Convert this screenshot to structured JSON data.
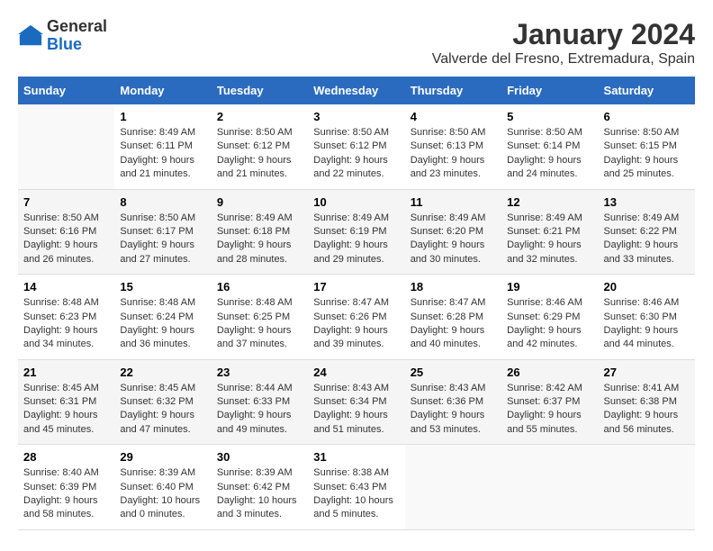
{
  "header": {
    "logo_line1": "General",
    "logo_line2": "Blue",
    "title": "January 2024",
    "subtitle": "Valverde del Fresno, Extremadura, Spain"
  },
  "days_of_week": [
    "Sunday",
    "Monday",
    "Tuesday",
    "Wednesday",
    "Thursday",
    "Friday",
    "Saturday"
  ],
  "weeks": [
    [
      {
        "day": "",
        "info": ""
      },
      {
        "day": "1",
        "info": "Sunrise: 8:49 AM\nSunset: 6:11 PM\nDaylight: 9 hours\nand 21 minutes."
      },
      {
        "day": "2",
        "info": "Sunrise: 8:50 AM\nSunset: 6:12 PM\nDaylight: 9 hours\nand 21 minutes."
      },
      {
        "day": "3",
        "info": "Sunrise: 8:50 AM\nSunset: 6:12 PM\nDaylight: 9 hours\nand 22 minutes."
      },
      {
        "day": "4",
        "info": "Sunrise: 8:50 AM\nSunset: 6:13 PM\nDaylight: 9 hours\nand 23 minutes."
      },
      {
        "day": "5",
        "info": "Sunrise: 8:50 AM\nSunset: 6:14 PM\nDaylight: 9 hours\nand 24 minutes."
      },
      {
        "day": "6",
        "info": "Sunrise: 8:50 AM\nSunset: 6:15 PM\nDaylight: 9 hours\nand 25 minutes."
      }
    ],
    [
      {
        "day": "7",
        "info": "Sunrise: 8:50 AM\nSunset: 6:16 PM\nDaylight: 9 hours\nand 26 minutes."
      },
      {
        "day": "8",
        "info": "Sunrise: 8:50 AM\nSunset: 6:17 PM\nDaylight: 9 hours\nand 27 minutes."
      },
      {
        "day": "9",
        "info": "Sunrise: 8:49 AM\nSunset: 6:18 PM\nDaylight: 9 hours\nand 28 minutes."
      },
      {
        "day": "10",
        "info": "Sunrise: 8:49 AM\nSunset: 6:19 PM\nDaylight: 9 hours\nand 29 minutes."
      },
      {
        "day": "11",
        "info": "Sunrise: 8:49 AM\nSunset: 6:20 PM\nDaylight: 9 hours\nand 30 minutes."
      },
      {
        "day": "12",
        "info": "Sunrise: 8:49 AM\nSunset: 6:21 PM\nDaylight: 9 hours\nand 32 minutes."
      },
      {
        "day": "13",
        "info": "Sunrise: 8:49 AM\nSunset: 6:22 PM\nDaylight: 9 hours\nand 33 minutes."
      }
    ],
    [
      {
        "day": "14",
        "info": "Sunrise: 8:48 AM\nSunset: 6:23 PM\nDaylight: 9 hours\nand 34 minutes."
      },
      {
        "day": "15",
        "info": "Sunrise: 8:48 AM\nSunset: 6:24 PM\nDaylight: 9 hours\nand 36 minutes."
      },
      {
        "day": "16",
        "info": "Sunrise: 8:48 AM\nSunset: 6:25 PM\nDaylight: 9 hours\nand 37 minutes."
      },
      {
        "day": "17",
        "info": "Sunrise: 8:47 AM\nSunset: 6:26 PM\nDaylight: 9 hours\nand 39 minutes."
      },
      {
        "day": "18",
        "info": "Sunrise: 8:47 AM\nSunset: 6:28 PM\nDaylight: 9 hours\nand 40 minutes."
      },
      {
        "day": "19",
        "info": "Sunrise: 8:46 AM\nSunset: 6:29 PM\nDaylight: 9 hours\nand 42 minutes."
      },
      {
        "day": "20",
        "info": "Sunrise: 8:46 AM\nSunset: 6:30 PM\nDaylight: 9 hours\nand 44 minutes."
      }
    ],
    [
      {
        "day": "21",
        "info": "Sunrise: 8:45 AM\nSunset: 6:31 PM\nDaylight: 9 hours\nand 45 minutes."
      },
      {
        "day": "22",
        "info": "Sunrise: 8:45 AM\nSunset: 6:32 PM\nDaylight: 9 hours\nand 47 minutes."
      },
      {
        "day": "23",
        "info": "Sunrise: 8:44 AM\nSunset: 6:33 PM\nDaylight: 9 hours\nand 49 minutes."
      },
      {
        "day": "24",
        "info": "Sunrise: 8:43 AM\nSunset: 6:34 PM\nDaylight: 9 hours\nand 51 minutes."
      },
      {
        "day": "25",
        "info": "Sunrise: 8:43 AM\nSunset: 6:36 PM\nDaylight: 9 hours\nand 53 minutes."
      },
      {
        "day": "26",
        "info": "Sunrise: 8:42 AM\nSunset: 6:37 PM\nDaylight: 9 hours\nand 55 minutes."
      },
      {
        "day": "27",
        "info": "Sunrise: 8:41 AM\nSunset: 6:38 PM\nDaylight: 9 hours\nand 56 minutes."
      }
    ],
    [
      {
        "day": "28",
        "info": "Sunrise: 8:40 AM\nSunset: 6:39 PM\nDaylight: 9 hours\nand 58 minutes."
      },
      {
        "day": "29",
        "info": "Sunrise: 8:39 AM\nSunset: 6:40 PM\nDaylight: 10 hours\nand 0 minutes."
      },
      {
        "day": "30",
        "info": "Sunrise: 8:39 AM\nSunset: 6:42 PM\nDaylight: 10 hours\nand 3 minutes."
      },
      {
        "day": "31",
        "info": "Sunrise: 8:38 AM\nSunset: 6:43 PM\nDaylight: 10 hours\nand 5 minutes."
      },
      {
        "day": "",
        "info": ""
      },
      {
        "day": "",
        "info": ""
      },
      {
        "day": "",
        "info": ""
      }
    ]
  ]
}
